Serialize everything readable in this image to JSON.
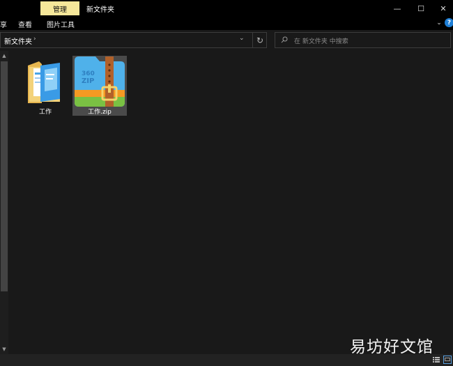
{
  "titlebar": {
    "manage_tab": "管理",
    "window_title": "新文件夹",
    "minimize_glyph": "—",
    "maximize_glyph": "☐",
    "close_glyph": "✕"
  },
  "ribbon": {
    "share_partial": "享",
    "view": "查看",
    "picture_tools": "图片工具",
    "toggle_glyph": "⌄",
    "help_glyph": "?"
  },
  "address": {
    "path": "新文件夹",
    "separator": "›",
    "dropdown_glyph": "⌄",
    "refresh_glyph": "↻"
  },
  "search": {
    "placeholder": "在 新文件夹 中搜索"
  },
  "items": [
    {
      "label": "工作",
      "icon": "folder-icon"
    },
    {
      "label": "工作.zip",
      "icon": "zip-archive-icon",
      "selected": true
    }
  ],
  "zip_icon_text": {
    "line1": "360",
    "line2": "ZIP"
  },
  "watermark": "易坊好文馆",
  "colors": {
    "manage_tab_bg": "#f5e79a",
    "accent_blue": "#1f7fd6",
    "zip_blue": "#4fb1ea",
    "zip_green": "#7ac143",
    "zip_orange": "#f59a23",
    "zip_strap": "#b2612a",
    "folder_yellow": "#f3d27a"
  }
}
